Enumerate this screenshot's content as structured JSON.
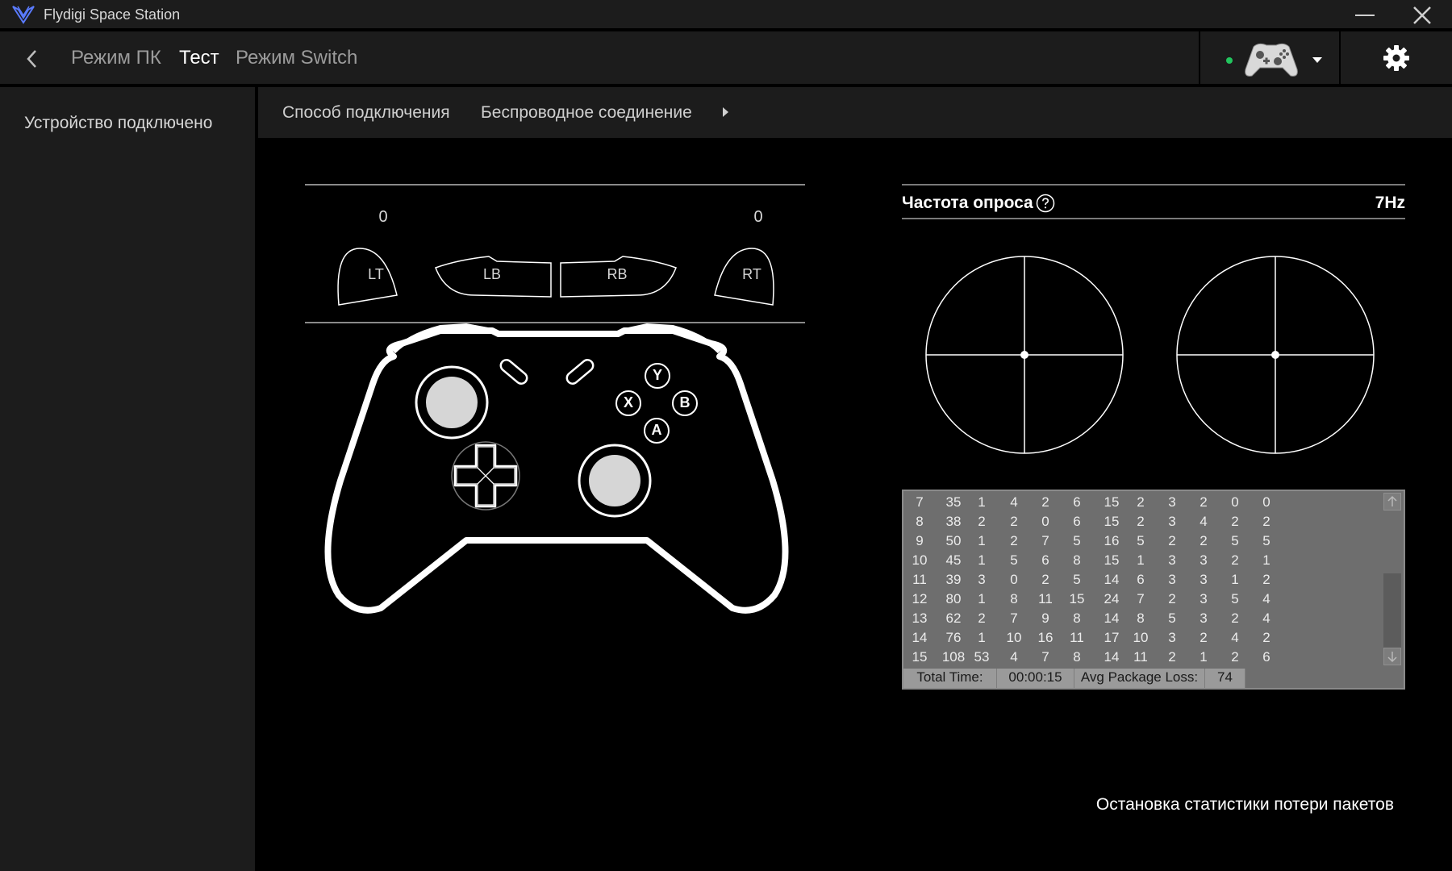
{
  "window": {
    "title": "Flydigi Space Station"
  },
  "nav": {
    "tabs": [
      {
        "label": "Режим ПК",
        "active": false
      },
      {
        "label": "Тест",
        "active": true
      },
      {
        "label": "Режим Switch",
        "active": false
      }
    ],
    "device_status_color": "#22c55e"
  },
  "sidebar": {
    "items": [
      {
        "label": "Устройство подключено"
      }
    ]
  },
  "breadcrumb": {
    "items": [
      "Способ подключения",
      "Беспроводное соединение"
    ]
  },
  "gamepad": {
    "lt_value": "0",
    "rt_value": "0",
    "labels": {
      "lt": "LT",
      "lb": "LB",
      "rb": "RB",
      "rt": "RT",
      "y": "Y",
      "x": "X",
      "b": "B",
      "a": "A"
    }
  },
  "polling": {
    "label": "Частота опроса",
    "value": "7Hz"
  },
  "stats": {
    "rows": [
      [
        "7",
        "35",
        "1",
        "4",
        "2",
        "6",
        "15",
        "2",
        "3",
        "2",
        "0",
        "0"
      ],
      [
        "8",
        "38",
        "2",
        "2",
        "0",
        "6",
        "15",
        "2",
        "3",
        "4",
        "2",
        "2"
      ],
      [
        "9",
        "50",
        "1",
        "2",
        "7",
        "5",
        "16",
        "5",
        "2",
        "2",
        "5",
        "5"
      ],
      [
        "10",
        "45",
        "1",
        "5",
        "6",
        "8",
        "15",
        "1",
        "3",
        "3",
        "2",
        "1"
      ],
      [
        "11",
        "39",
        "3",
        "0",
        "2",
        "5",
        "14",
        "6",
        "3",
        "3",
        "1",
        "2"
      ],
      [
        "12",
        "80",
        "1",
        "8",
        "11",
        "15",
        "24",
        "7",
        "2",
        "3",
        "5",
        "4"
      ],
      [
        "13",
        "62",
        "2",
        "7",
        "9",
        "8",
        "14",
        "8",
        "5",
        "3",
        "2",
        "4"
      ],
      [
        "14",
        "76",
        "1",
        "10",
        "16",
        "11",
        "17",
        "10",
        "3",
        "2",
        "4",
        "2"
      ],
      [
        "15",
        "108",
        "53",
        "4",
        "7",
        "8",
        "14",
        "11",
        "2",
        "1",
        "2",
        "6"
      ]
    ],
    "footer": {
      "total_time_label": "Total Time:",
      "total_time_value": "00:00:15",
      "avg_loss_label": "Avg Package Loss:",
      "avg_loss_value": "74"
    }
  },
  "actions": {
    "stop_label": "Остановка статистики потери пакетов"
  }
}
